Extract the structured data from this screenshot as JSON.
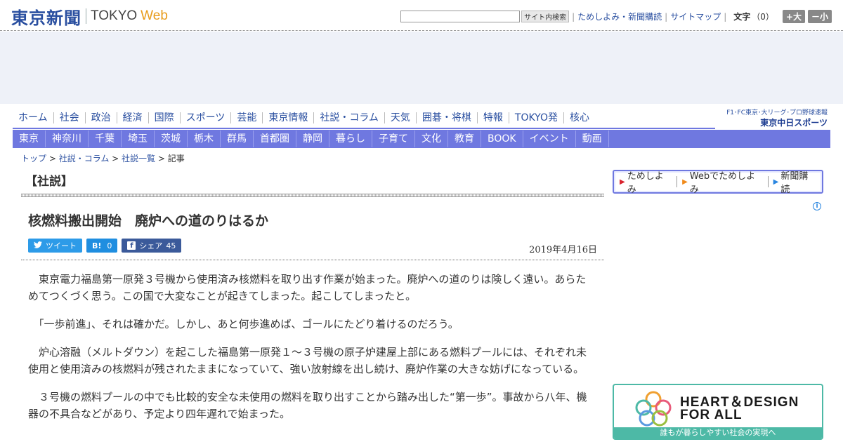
{
  "header": {
    "logo_kanji": "東京新聞",
    "logo_tokyo": "TOKYO",
    "logo_web": "Web",
    "search_button": "サイト内検索",
    "links": [
      "ためしよみ・新聞購読",
      "サイトマップ"
    ],
    "fontsize_label": "文字",
    "fontsize_value": "（0）",
    "font_larger": "+大",
    "font_smaller": "－小"
  },
  "main_nav": [
    "ホーム",
    "社会",
    "政治",
    "経済",
    "国際",
    "スポーツ",
    "芸能",
    "東京情報",
    "社説・コラム",
    "天気",
    "囲碁・将棋",
    "特報",
    "TOKYO発",
    "核心"
  ],
  "chunichi": {
    "top": "F1･FC東京･大リーグ･プロ野球速報",
    "bottom": "東京中日スポーツ"
  },
  "sub_nav": [
    "東京",
    "神奈川",
    "千葉",
    "埼玉",
    "茨城",
    "栃木",
    "群馬",
    "首都圏",
    "静岡",
    "暮らし",
    "子育て",
    "文化",
    "教育",
    "BOOK",
    "イベント",
    "動画"
  ],
  "breadcrumb": {
    "items": [
      "トップ",
      "社説・コラム",
      "社説一覧"
    ],
    "current": "記事",
    "sep": " > "
  },
  "article": {
    "section": "【社説】",
    "title": "核燃料搬出開始　廃炉への道のりはるか",
    "date": "2019年4月16日",
    "share": {
      "tweet": "ツイート",
      "hatena": "B!",
      "hatena_count": "0",
      "facebook": "シェア",
      "facebook_count": "45"
    },
    "paragraphs": [
      "　東京電力福島第一原発３号機から使用済み核燃料を取り出す作業が始まった。廃炉への道のりは険しく遠い。あらためてつくづく思う。この国で大変なことが起きてしまった。起こしてしまったと。",
      "　「一歩前進」、それは確かだ。しかし、あと何歩進めば、ゴールにたどり着けるのだろう。",
      "　炉心溶融（メルトダウン）を起こした福島第一原発１～３号機の原子炉建屋上部にある燃料プールには、それぞれ未使用と使用済みの核燃料が残されたままになっていて、強い放射線を出し続け、廃炉作業の大きな妨げになっている。",
      "　３号機の燃料プールの中でも比較的安全な未使用の燃料を取り出すことから踏み出した“第一歩”。事故から八年、機器の不具合などがあり、予定より四年遅れで始まった。"
    ]
  },
  "subscribe_box": {
    "links": [
      "ためしよみ",
      "Webでためしよみ",
      "新聞購読"
    ]
  },
  "banner": {
    "line1": "HEART＆DESIGN",
    "line2": "FOR ALL",
    "tagline": "誰もが暮らしやすい社会の実現へ"
  },
  "colors": {
    "brand_blue": "#2a4fa0",
    "nav_purple": "#6f78e0",
    "web_orange": "#e89b1a",
    "banner_teal": "#4db9a6"
  }
}
